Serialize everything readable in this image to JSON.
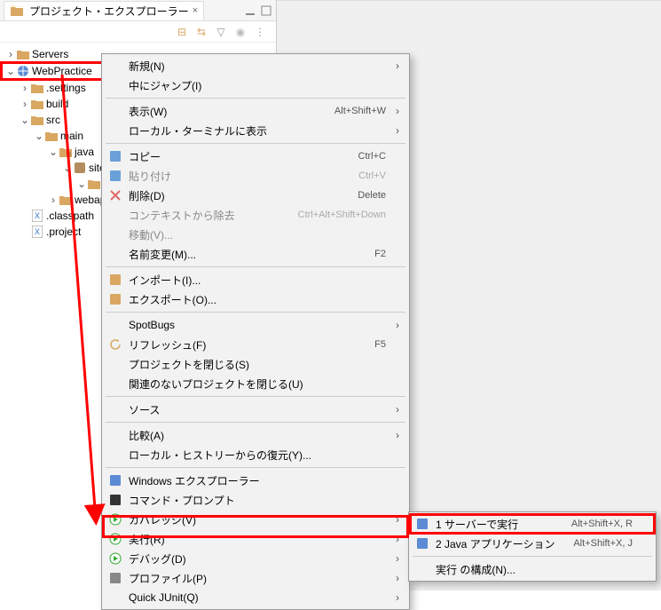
{
  "view": {
    "title": "プロジェクト・エクスプローラー"
  },
  "tree": {
    "servers": "Servers",
    "project": "WebPractice",
    "settings": ".settings",
    "build": "build",
    "src": "src",
    "main": "main",
    "java": "java",
    "site": "site",
    "webapp": "webapp",
    "classpath": ".classpath",
    "projectfile": ".project"
  },
  "menu": [
    {
      "label": "新規(N)",
      "sub": true
    },
    {
      "label": "中にジャンプ(I)"
    },
    {
      "sep": true
    },
    {
      "label": "表示(W)",
      "accel": "Alt+Shift+W",
      "sub": true
    },
    {
      "label": "ローカル・ターミナルに表示",
      "sub": true
    },
    {
      "sep": true
    },
    {
      "label": "コピー",
      "icon": "copy",
      "accel": "Ctrl+C"
    },
    {
      "label": "貼り付け",
      "icon": "paste",
      "accel": "Ctrl+V",
      "disabled": true
    },
    {
      "label": "削除(D)",
      "icon": "delete",
      "accel": "Delete"
    },
    {
      "label": "コンテキストから除去",
      "accel": "Ctrl+Alt+Shift+Down",
      "disabled": true
    },
    {
      "label": "移動(V)...",
      "disabled": true
    },
    {
      "label": "名前変更(M)...",
      "accel": "F2"
    },
    {
      "sep": true
    },
    {
      "label": "インポート(I)...",
      "icon": "import"
    },
    {
      "label": "エクスポート(O)...",
      "icon": "export"
    },
    {
      "sep": true
    },
    {
      "label": "SpotBugs",
      "sub": true
    },
    {
      "label": "リフレッシュ(F)",
      "icon": "refresh",
      "accel": "F5"
    },
    {
      "label": "プロジェクトを閉じる(S)"
    },
    {
      "label": "関連のないプロジェクトを閉じる(U)"
    },
    {
      "sep": true
    },
    {
      "label": "ソース",
      "sub": true
    },
    {
      "sep": true
    },
    {
      "label": "比較(A)",
      "sub": true
    },
    {
      "label": "ローカル・ヒストリーからの復元(Y)..."
    },
    {
      "sep": true
    },
    {
      "label": "Windows エクスプローラー",
      "icon": "win"
    },
    {
      "label": "コマンド・プロンプト",
      "icon": "cmd"
    },
    {
      "label": "カバレッジ(V)",
      "icon": "coverage",
      "sub": true
    },
    {
      "label": "実行(R)",
      "icon": "run",
      "sub": true,
      "hi": true
    },
    {
      "label": "デバッグ(D)",
      "icon": "debug",
      "sub": true
    },
    {
      "label": "プロファイル(P)",
      "icon": "profile",
      "sub": true
    },
    {
      "label": "Quick JUnit(Q)",
      "sub": true
    }
  ],
  "submenu": [
    {
      "label": "1 サーバーで実行",
      "icon": "server",
      "accel": "Alt+Shift+X, R",
      "hi": true
    },
    {
      "label": "2 Java アプリケーション",
      "icon": "java",
      "accel": "Alt+Shift+X, J"
    },
    {
      "sep": true
    },
    {
      "label": "実行 の構成(N)..."
    }
  ]
}
